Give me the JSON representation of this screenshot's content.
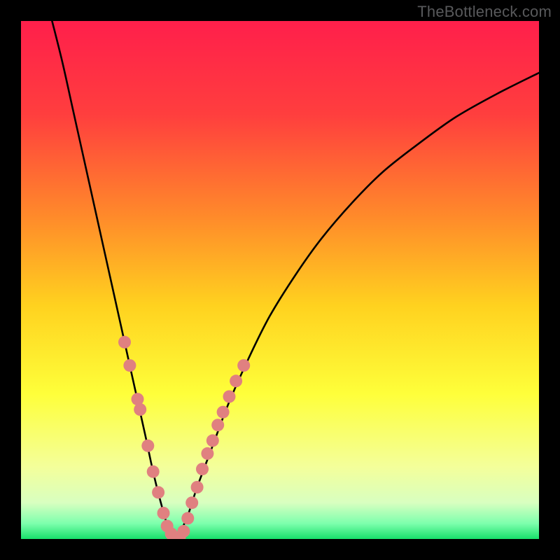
{
  "watermark": "TheBottleneck.com",
  "chart_data": {
    "type": "line",
    "title": "",
    "xlabel": "",
    "ylabel": "",
    "xlim": [
      0,
      100
    ],
    "ylim": [
      0,
      100
    ],
    "grid": false,
    "legend": false,
    "background_gradient_stops": [
      {
        "pct": 0,
        "color": "#ff1f4b"
      },
      {
        "pct": 18,
        "color": "#ff3e3e"
      },
      {
        "pct": 38,
        "color": "#ff8b2a"
      },
      {
        "pct": 55,
        "color": "#ffd21f"
      },
      {
        "pct": 72,
        "color": "#feff3a"
      },
      {
        "pct": 86,
        "color": "#f4ff9a"
      },
      {
        "pct": 93,
        "color": "#d8ffc0"
      },
      {
        "pct": 97,
        "color": "#7dffad"
      },
      {
        "pct": 100,
        "color": "#18e06a"
      }
    ],
    "series": [
      {
        "name": "left-branch",
        "x": [
          6,
          8,
          10,
          12,
          14,
          16,
          18,
          20,
          22,
          24,
          25.5,
          27,
          28.5,
          30
        ],
        "y": [
          100,
          92,
          83,
          74,
          65,
          56,
          47,
          38,
          29,
          20,
          13,
          7,
          2,
          0
        ]
      },
      {
        "name": "right-branch",
        "x": [
          30,
          32,
          34,
          37,
          40,
          44,
          48,
          53,
          58,
          64,
          70,
          77,
          84,
          92,
          100
        ],
        "y": [
          0,
          4,
          10,
          18,
          26,
          35,
          43,
          51,
          58,
          65,
          71,
          76.5,
          81.5,
          86,
          90
        ]
      }
    ],
    "highlight_dots": {
      "name": "pink-dots",
      "color": "#e08080",
      "radius_px": 9,
      "points": [
        {
          "x": 20.0,
          "y": 38.0
        },
        {
          "x": 21.0,
          "y": 33.5
        },
        {
          "x": 22.5,
          "y": 27.0
        },
        {
          "x": 23.0,
          "y": 25.0
        },
        {
          "x": 24.5,
          "y": 18.0
        },
        {
          "x": 25.5,
          "y": 13.0
        },
        {
          "x": 26.5,
          "y": 9.0
        },
        {
          "x": 27.5,
          "y": 5.0
        },
        {
          "x": 28.2,
          "y": 2.5
        },
        {
          "x": 29.0,
          "y": 1.0
        },
        {
          "x": 29.8,
          "y": 0.3
        },
        {
          "x": 30.6,
          "y": 0.3
        },
        {
          "x": 31.4,
          "y": 1.5
        },
        {
          "x": 32.2,
          "y": 4.0
        },
        {
          "x": 33.0,
          "y": 7.0
        },
        {
          "x": 34.0,
          "y": 10.0
        },
        {
          "x": 35.0,
          "y": 13.5
        },
        {
          "x": 36.0,
          "y": 16.5
        },
        {
          "x": 37.0,
          "y": 19.0
        },
        {
          "x": 38.0,
          "y": 22.0
        },
        {
          "x": 39.0,
          "y": 24.5
        },
        {
          "x": 40.2,
          "y": 27.5
        },
        {
          "x": 41.5,
          "y": 30.5
        },
        {
          "x": 43.0,
          "y": 33.5
        }
      ]
    }
  }
}
